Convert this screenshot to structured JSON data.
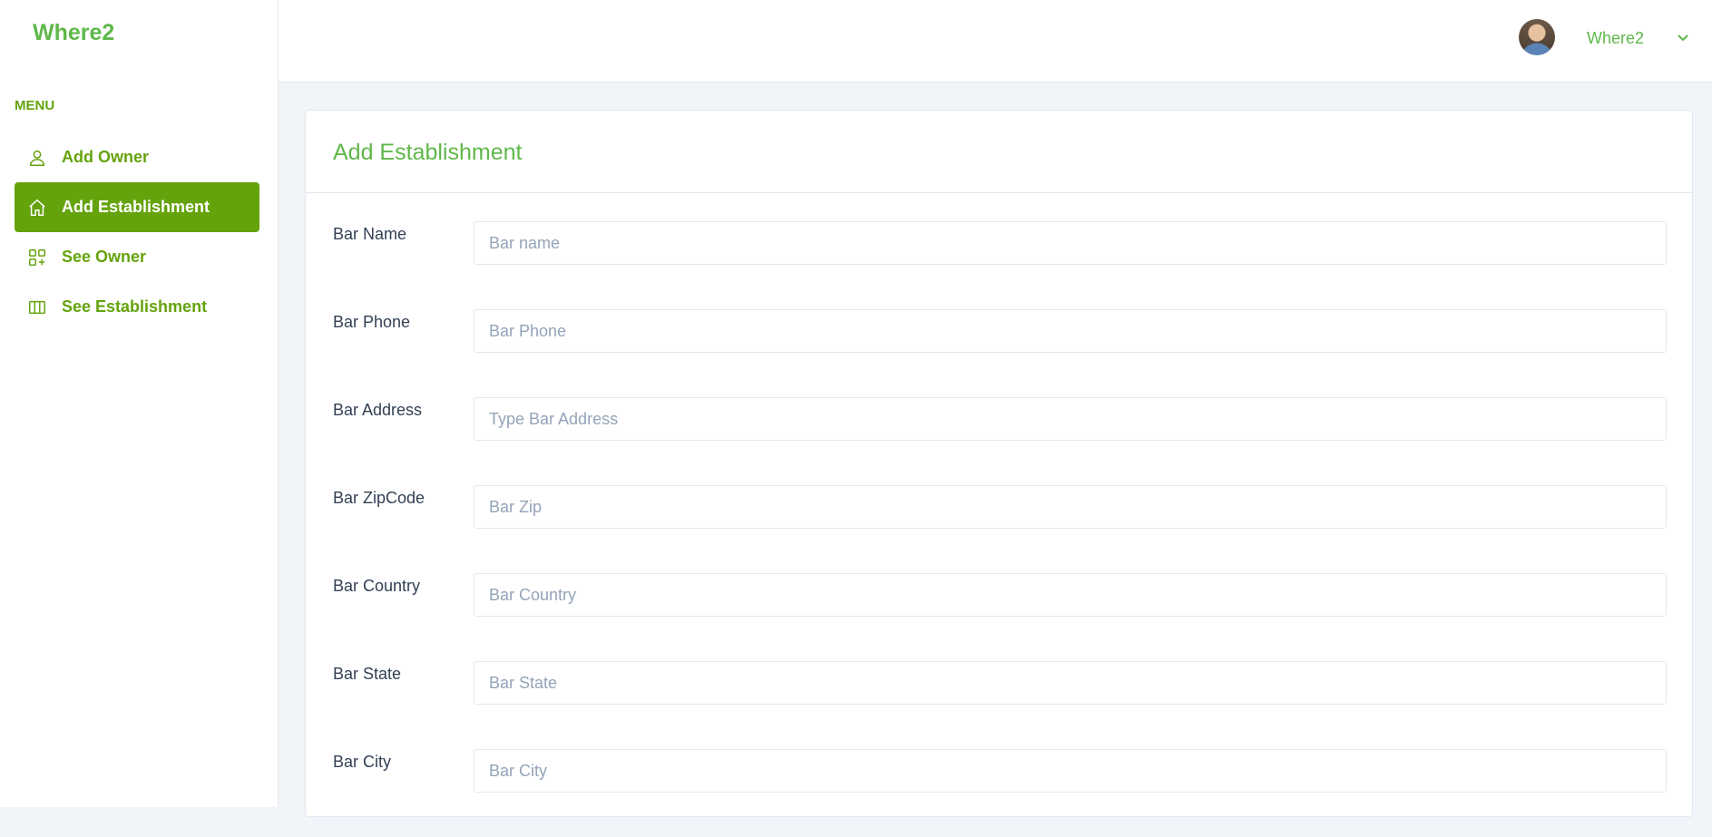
{
  "brand": "Where2",
  "sidebar": {
    "menu_heading": "MENU",
    "items": [
      {
        "label": "Add Owner",
        "icon": "user-icon",
        "active": false
      },
      {
        "label": "Add Establishment",
        "icon": "home-icon",
        "active": true
      },
      {
        "label": "See Owner",
        "icon": "grid-plus-icon",
        "active": false
      },
      {
        "label": "See Establishment",
        "icon": "columns-icon",
        "active": false
      }
    ]
  },
  "header": {
    "user_name": "Where2"
  },
  "main": {
    "title": "Add Establishment",
    "fields": [
      {
        "label": "Bar Name",
        "placeholder": "Bar name"
      },
      {
        "label": "Bar Phone",
        "placeholder": "Bar Phone"
      },
      {
        "label": "Bar Address",
        "placeholder": "Type Bar Address"
      },
      {
        "label": "Bar ZipCode",
        "placeholder": "Bar Zip"
      },
      {
        "label": "Bar Country",
        "placeholder": "Bar Country"
      },
      {
        "label": "Bar State",
        "placeholder": "Bar State"
      },
      {
        "label": "Bar City",
        "placeholder": "Bar City"
      }
    ]
  },
  "colors": {
    "accent": "#65a30d",
    "brand_text": "#5fb84a",
    "background": "#f1f5f9"
  }
}
